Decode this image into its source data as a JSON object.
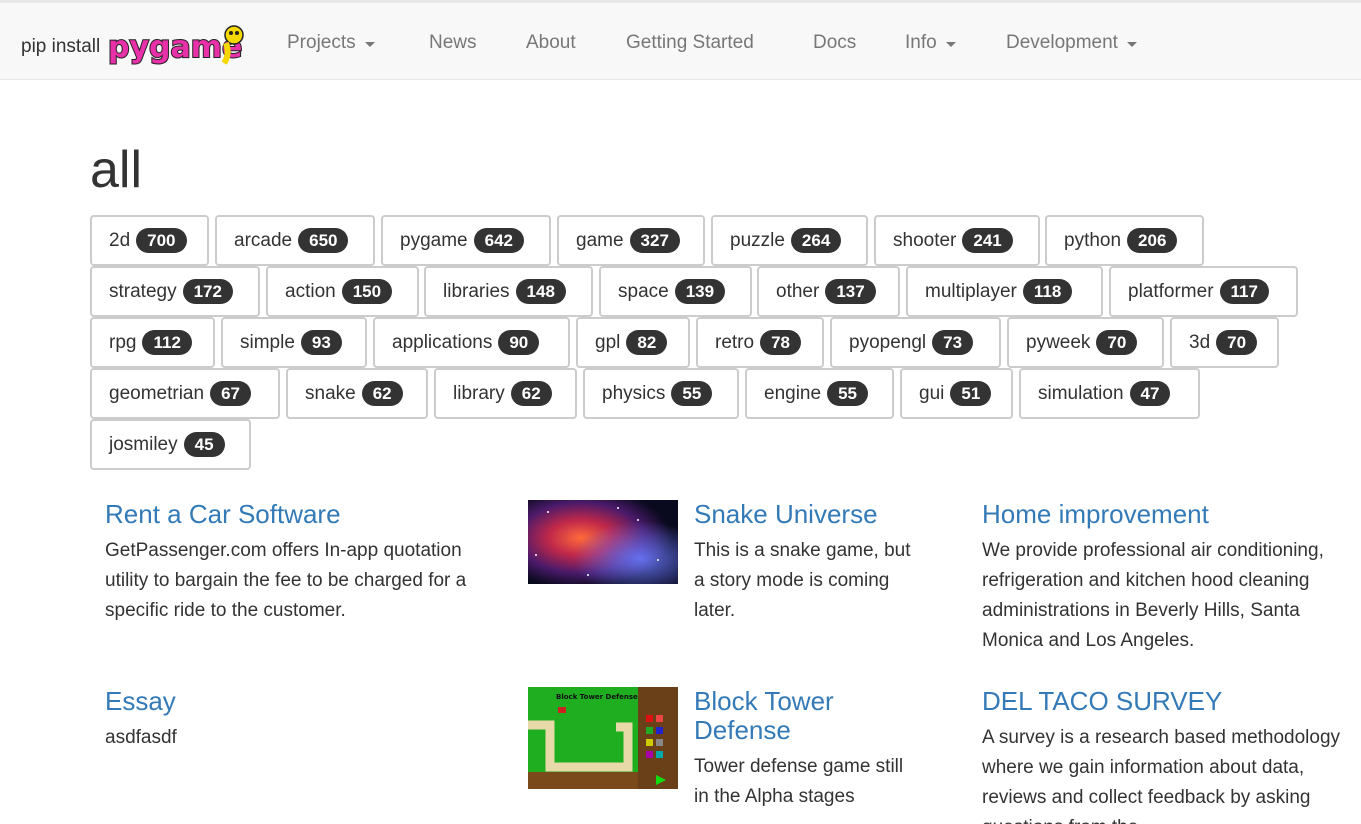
{
  "nav": {
    "brand_text": "pip install",
    "logo_text": "pygame",
    "items": [
      {
        "label": "Projects",
        "dropdown": true
      },
      {
        "label": "News",
        "dropdown": false
      },
      {
        "label": "About",
        "dropdown": false
      },
      {
        "label": "Getting Started",
        "dropdown": false
      },
      {
        "label": "Docs",
        "dropdown": false
      },
      {
        "label": "Info",
        "dropdown": true
      },
      {
        "label": "Development",
        "dropdown": true
      }
    ]
  },
  "page": {
    "title": "all"
  },
  "tags": [
    {
      "name": "2d",
      "count": "700"
    },
    {
      "name": "arcade",
      "count": "650"
    },
    {
      "name": "pygame",
      "count": "642"
    },
    {
      "name": "game",
      "count": "327"
    },
    {
      "name": "puzzle",
      "count": "264"
    },
    {
      "name": "shooter",
      "count": "241"
    },
    {
      "name": "python",
      "count": "206"
    },
    {
      "name": "strategy",
      "count": "172"
    },
    {
      "name": "action",
      "count": "150"
    },
    {
      "name": "libraries",
      "count": "148"
    },
    {
      "name": "space",
      "count": "139"
    },
    {
      "name": "other",
      "count": "137"
    },
    {
      "name": "multiplayer",
      "count": "118"
    },
    {
      "name": "platformer",
      "count": "117"
    },
    {
      "name": "rpg",
      "count": "112"
    },
    {
      "name": "simple",
      "count": "93"
    },
    {
      "name": "applications",
      "count": "90"
    },
    {
      "name": "gpl",
      "count": "82"
    },
    {
      "name": "retro",
      "count": "78"
    },
    {
      "name": "pyopengl",
      "count": "73"
    },
    {
      "name": "pyweek",
      "count": "70"
    },
    {
      "name": "3d",
      "count": "70"
    },
    {
      "name": "geometrian",
      "count": "67"
    },
    {
      "name": "snake",
      "count": "62"
    },
    {
      "name": "library",
      "count": "62"
    },
    {
      "name": "physics",
      "count": "55"
    },
    {
      "name": "engine",
      "count": "55"
    },
    {
      "name": "gui",
      "count": "51"
    },
    {
      "name": "simulation",
      "count": "47"
    },
    {
      "name": "josmiley",
      "count": "45"
    }
  ],
  "projects": [
    {
      "title": "Rent a Car Software",
      "description": "GetPassenger.com offers In-app quotation utility to bargain the fee to be charged for a specific ride to the customer."
    },
    {
      "title": "Snake Universe",
      "description": "This is a snake game, but a story mode is coming later.",
      "thumbnail": "nebula-space-image"
    },
    {
      "title": "Home improvement",
      "description": "We provide professional air conditioning, refrigeration and kitchen hood cleaning administrations in Beverly Hills, Santa Monica and Los Angeles."
    },
    {
      "title": "Essay",
      "description": "asdfasdf"
    },
    {
      "title": "Block Tower Defense",
      "description": "Tower defense game still in the Alpha stages",
      "thumbnail": "tower-defense-screenshot",
      "thumbnail_caption": "Block Tower Defense"
    },
    {
      "title": "DEL TACO SURVEY",
      "description": "A survey is a research based methodology where we gain information about data, reviews and collect feedback by asking questions from the"
    }
  ],
  "colors": {
    "link": "#337ab7",
    "badge": "#333333",
    "nav_text": "#777777",
    "nav_bg": "#f8f8f8"
  }
}
